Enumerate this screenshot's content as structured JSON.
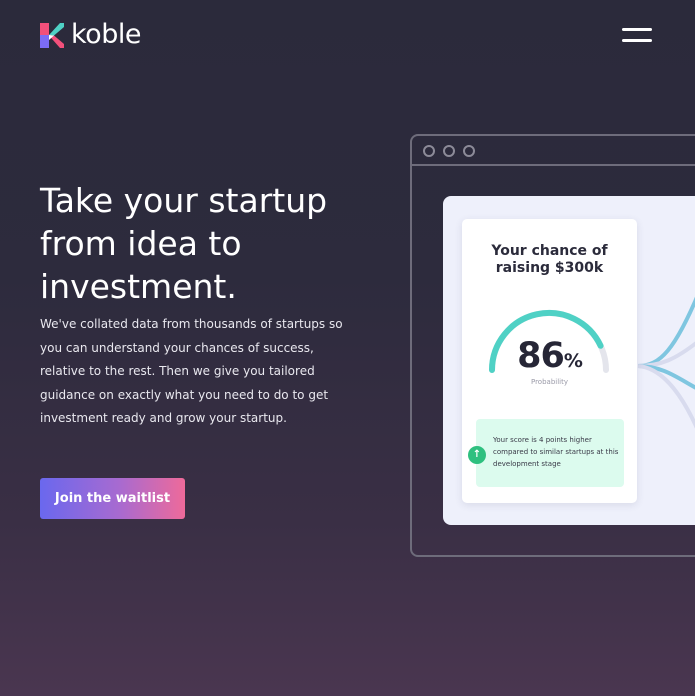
{
  "header": {
    "brand": "koble",
    "logo_colors": [
      "#f2507b",
      "#7b6cf6",
      "#4fd1c5",
      "#ffffff"
    ],
    "menu_icon": "hamburger-icon"
  },
  "hero": {
    "title_lines": [
      "Take your startup",
      "from idea to",
      "investment."
    ],
    "body": "We've collated data from thousands of startups so you can understand your chances of success, relative to the rest. Then we give you tailored guidance on exactly what you need to do to get investment ready and grow your startup.",
    "cta_label": "Join the waitlist"
  },
  "card": {
    "title_line1": "Your chance of",
    "title_line2": "raising $300k",
    "score": "86",
    "score_unit": "%",
    "score_value": 86,
    "score_label": "Probability",
    "note": "Your score is 4 points higher compared to similar startups at this development stage",
    "note_icon": "arrow-up-icon"
  },
  "colors": {
    "accent_start": "#6a68ee",
    "accent_end": "#ee6a9a",
    "gauge": "#4fd1c5",
    "positive": "#2ec07f"
  }
}
